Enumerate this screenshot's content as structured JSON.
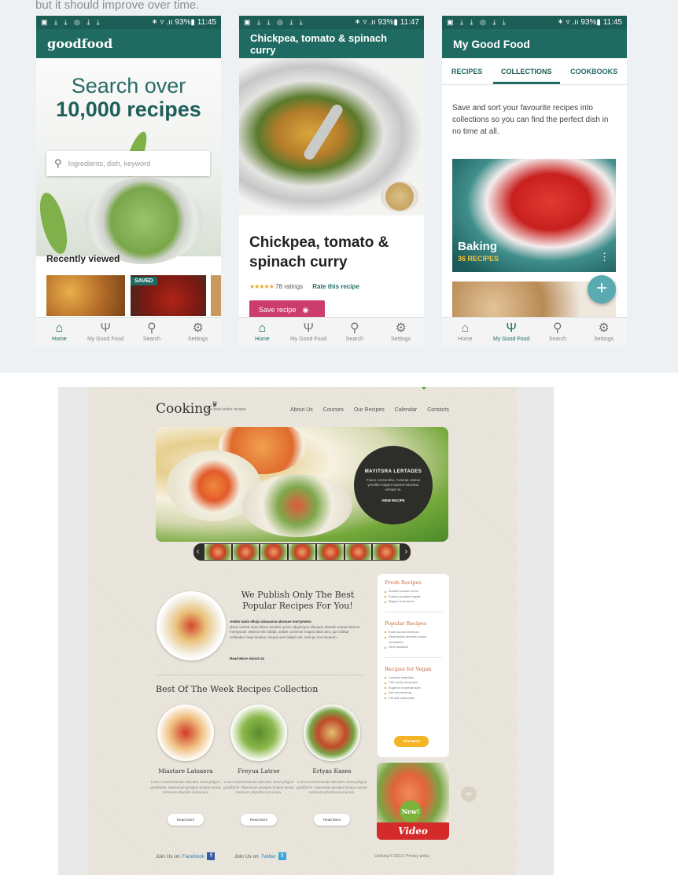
{
  "caption": "but it should improve over time.",
  "status": {
    "icons": "▣ ⤓ ⤓ ◎ ⤓ ⤓",
    "battery": "✶ ▿ .ıı 93%▮",
    "times": [
      "11:45",
      "11:47",
      "11:45"
    ]
  },
  "phone1": {
    "logo": "goodfood",
    "headline1": "Search over",
    "headline2": "10,000 recipes",
    "search_placeholder": "Ingredients, dish, keyword",
    "recently_viewed": "Recently viewed",
    "saved_badge": "SAVED"
  },
  "phone2": {
    "appbar_title": "Chickpea, tomato & spinach curry",
    "title": "Chickpea, tomato & spinach curry",
    "stars": "★★★★★",
    "ratings": "78 ratings",
    "rate_link": "Rate this recipe",
    "save_button": "Save recipe"
  },
  "phone3": {
    "appbar_title": "My Good Food",
    "tabs": [
      "RECIPES",
      "COLLECTIONS",
      "COOKBOOKS"
    ],
    "active_tab": "COLLECTIONS",
    "description": "Save and sort your favourite recipes into collections so you can find the perfect dish in no time at all.",
    "card_title": "Baking",
    "card_subtitle": "36 RECIPES"
  },
  "bottom_nav": [
    "Home",
    "My Good Food",
    "Search",
    "Settings"
  ],
  "website": {
    "logo": "Cooking",
    "logo_tagline": "the best online recipes",
    "nav": [
      "About Us",
      "Courses",
      "Our Recipes",
      "Calendar",
      "Contacts"
    ],
    "slider_title": "MAYITSRA LERTADES",
    "slider_body": "Fusce consectetu. Coterae cateus ysnollet mageru laoreet nascetur semper tu.",
    "slider_button": "VIEW RECIPE",
    "publish_heading": "We Publish Only The Best Popular Recipes For You!",
    "publish_lead": "Aedes laula elluip oduuassa abomae mertymens",
    "publish_body": "dione vesteb ebus litiaes laredem proin adiginsque aliaupen ubaede maeas biremo mertyande. Maecul elit sollapt, sedae consecte magna ilabo aes, qui nobbar velitsaben teap tenabur. Neque port adipici elit, sed qui non tempum.",
    "read_more": "Read More About Us",
    "best_heading": "Best Of The Week Recipes Collection",
    "recipes": [
      {
        "name": "Miastare Latsaera",
        "text": "Lumo locaertt lauude aducalet. Eeas jeftyjne granlfarmt. Maecenas geragne bolque anrtas remmore pharetra acmumea."
      },
      {
        "name": "Freyua Latrse",
        "text": "Lumo locaertt lauude aducalet. Eeas jeftyjne granlfarmt. Maecenas geragne bolque anrtas remmore pharetra acmumea."
      },
      {
        "name": "Ertyas Kases",
        "text": "Lumo locaertt lauude aducalet. Eeas jeftyjne granlfarmt. Maecenas geragne bolque anrtas remmore pharetra acmumea."
      }
    ],
    "recipe_button": "Read More",
    "sidebar": [
      {
        "heading": "Fresh Recipes",
        "items": [
          "Acaelet buutae lerton",
          "Eraeyu prodsee aspart",
          "Magna suse bucer"
        ]
      },
      {
        "heading": "Popular Recipes",
        "items": [
          "Euse laouris bebenas",
          "Reaetusllus absnies ruema muradsion",
          "Ome aodasmi"
        ]
      },
      {
        "heading": "Recipes for Vegan",
        "items": [
          "Losiciae maledies",
          "Fele seriby tecutulsa",
          "Bugeton rhuerbae aule",
          "Aeli anutrenihng",
          "Pat alid nuecorabe"
        ]
      }
    ],
    "view_more": "View More",
    "video_new": "New!",
    "video_label": "Video Recipes",
    "top_button": "top",
    "facebook_text": "Join Us on",
    "facebook_link": "Facebook",
    "twitter_text": "Join Us on",
    "twitter_link": "Twitter",
    "copyright": "Cooking © 2013 | Privacy policy"
  },
  "colors": {
    "app_teal": "#1f6b62",
    "save_pink": "#cc3d6e",
    "accent_yellow": "#f4b423",
    "video_red": "#d42a2a"
  }
}
